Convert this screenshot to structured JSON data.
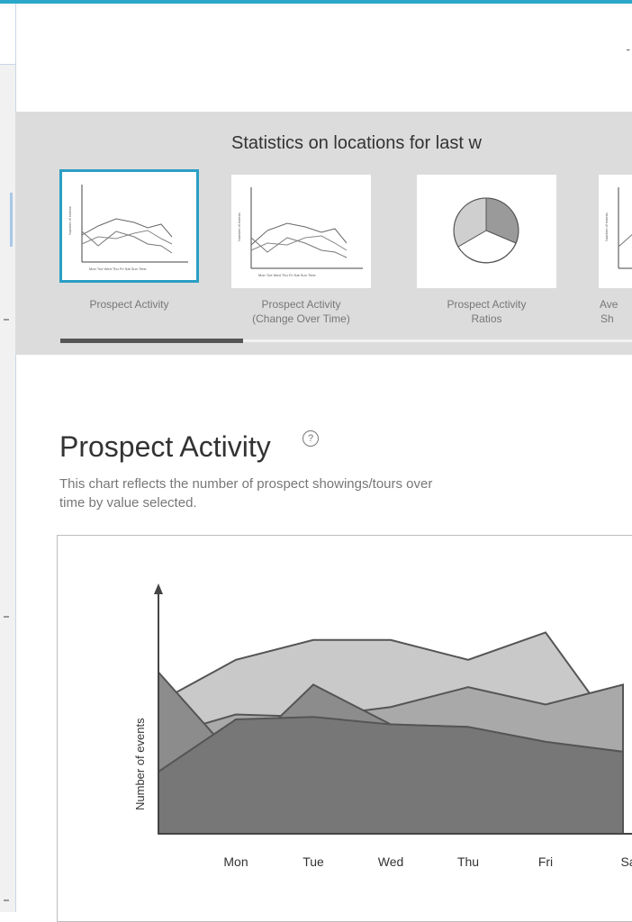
{
  "header": {
    "truncated_label": "-"
  },
  "stats": {
    "title": "Statistics on locations for last w",
    "thumbnails": [
      {
        "label_line1": "Prospect Activity",
        "label_line2": "",
        "selected": true,
        "kind": "line"
      },
      {
        "label_line1": "Prospect Activity",
        "label_line2": "(Change Over Time)",
        "selected": false,
        "kind": "line"
      },
      {
        "label_line1": "Prospect Activity",
        "label_line2": "Ratios",
        "selected": false,
        "kind": "pie"
      },
      {
        "label_line1": "Ave",
        "label_line2": "Sh",
        "selected": false,
        "kind": "line"
      }
    ]
  },
  "section": {
    "title": "Prospect Activity",
    "help": "?",
    "description": "This chart reflects the number of prospect showings/tours over time by value selected."
  },
  "chart_data": {
    "type": "area",
    "title": "",
    "xlabel": "",
    "ylabel": "Number of events",
    "categories": [
      "Mon",
      "Tue",
      "Wed",
      "Thu",
      "Fri",
      "Sa"
    ],
    "x_visible_points": [
      "start",
      "Mon",
      "Tue",
      "Wed",
      "Thu",
      "Fri",
      "Sa"
    ],
    "series": [
      {
        "values": [
          5.3,
          7.0,
          7.8,
          7.8,
          7.0,
          8.1,
          3.8
        ],
        "color": "#c9c9c9"
      },
      {
        "values": [
          3.9,
          4.8,
          4.7,
          5.1,
          5.9,
          5.2,
          6.0
        ],
        "color": "#a9a9a9"
      },
      {
        "values": [
          6.5,
          3.0,
          6.0,
          4.4,
          4.3,
          3.7,
          3.3
        ],
        "color": "#8c8c8c"
      },
      {
        "values": [
          2.5,
          4.6,
          4.7,
          4.4,
          4.3,
          3.7,
          3.3
        ],
        "color": "#777777"
      }
    ],
    "ylim": [
      0,
      10
    ],
    "grid": false
  }
}
